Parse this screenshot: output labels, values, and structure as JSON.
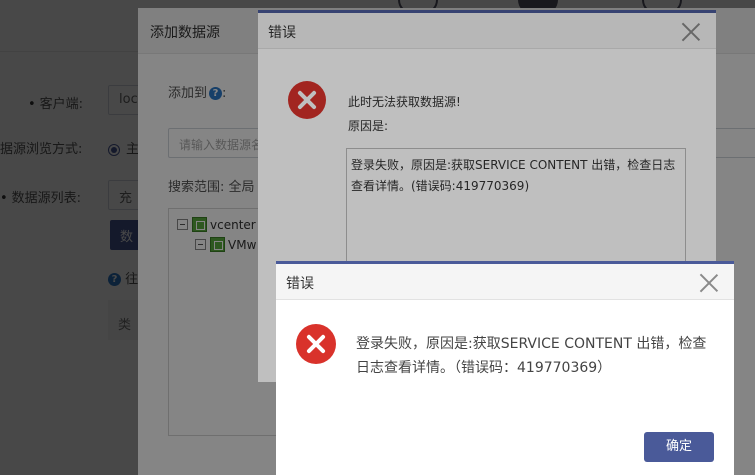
{
  "background": {
    "client_label": "客户端:",
    "client_value": "loc",
    "browse_label": "据源浏览方式:",
    "browse_option": "主",
    "list_label": "数据源列表:",
    "list_value": "充",
    "btn_label": "数",
    "hint_text": "往",
    "card_text": "类"
  },
  "add_dialog": {
    "title": "添加数据源",
    "add_to_label": "添加到",
    "search_placeholder": "请输入数据源名称",
    "scope_label": "搜索范围: 全局",
    "tree": [
      {
        "label": "vcenter"
      },
      {
        "label": "VMw"
      }
    ]
  },
  "error_dialog_1": {
    "title": "错误",
    "line1": "此时无法获取数据源!",
    "line2": "原因是:",
    "detail": "登录失败，原因是:获取SERVICE CONTENT 出错，检查日志查看详情。(错误码:419770369)"
  },
  "error_dialog_2": {
    "title": "错误",
    "message": "登录失败，原因是:获取SERVICE CONTENT 出错，检查日志查看详情。（错误码：419770369）",
    "ok_label": "确定"
  },
  "colors": {
    "accent": "#4a5a99",
    "error": "#d9322b"
  }
}
